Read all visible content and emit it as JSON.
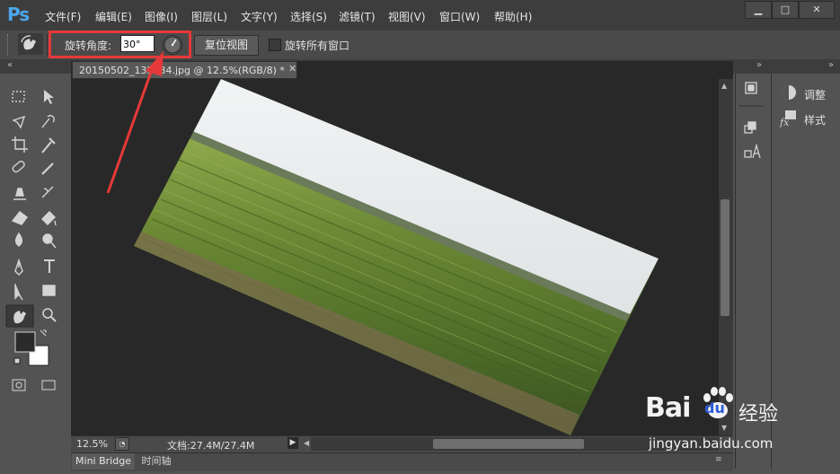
{
  "app": {
    "logo": "Ps"
  },
  "menu": [
    "文件(F)",
    "编辑(E)",
    "图像(I)",
    "图层(L)",
    "文字(Y)",
    "选择(S)",
    "滤镜(T)",
    "视图(V)",
    "窗口(W)",
    "帮助(H)"
  ],
  "window_controls": {
    "minimize": "▁",
    "maximize": "□",
    "close": "✕"
  },
  "options": {
    "rotate_angle_label": "旋转角度:",
    "rotate_angle_value": "30°",
    "reset_view_label": "复位视图",
    "rotate_all_label": "旋转所有窗口"
  },
  "document": {
    "tab_title": "20150502_135634.jpg @ 12.5%(RGB/8) *"
  },
  "status": {
    "zoom": "12.5%",
    "doc_info": "文档:27.4M/27.4M"
  },
  "bottom_tabs": [
    "Mini Bridge",
    "时间轴"
  ],
  "right_panels": {
    "adjust": "调整",
    "styles": "样式"
  },
  "watermark": {
    "brand": "Bai",
    "brand2": "du",
    "suffix": "经验",
    "url": "jingyan.baidu.com"
  },
  "icons": [
    "move-icon",
    "marquee-icon",
    "lasso-icon",
    "quick-select-icon",
    "crop-icon",
    "eyedropper-icon",
    "healing-icon",
    "brush-icon",
    "stamp-icon",
    "history-brush-icon",
    "eraser-icon",
    "bucket-icon",
    "blur-icon",
    "dodge-icon",
    "pen-icon",
    "type-icon",
    "path-select-icon",
    "rectangle-icon",
    "hand-icon",
    "zoom-icon",
    "rotate-view-icon"
  ],
  "colors": {
    "highlight": "#e63939",
    "ps_blue": "#4aa8f0"
  }
}
